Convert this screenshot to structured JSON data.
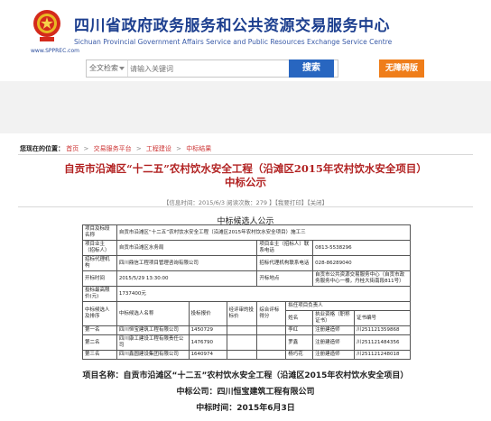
{
  "header": {
    "site_title": "四川省政府政务服务和公共资源交易服务中心",
    "site_subtitle": "Sichuan Provincial Government Affairs Service and Public Resources Exchange Service Centre",
    "domain": "www.SPPREC.com"
  },
  "search": {
    "scope": "全文检索",
    "placeholder": "请输入关键词",
    "button": "搜索",
    "accessibility_button": "无障碍版"
  },
  "breadcrumb": {
    "label": "您现在的位置：",
    "items": [
      "首页",
      "交易服务平台",
      "工程建设",
      "中标结果"
    ]
  },
  "article": {
    "title_line1": "自贡市沿滩区“十二五”农村饮水安全工程（沿滩区2015年农村饮水安全项目）",
    "title_line2": "中标公示",
    "meta": "【信息时间：2015/6/3  阅读次数：279 】【我要打印】【关闭】"
  },
  "notice": {
    "title": "中标候选人公示",
    "rows": {
      "project_name_label": "项目及标段名称",
      "project_name": "自贡市沿滩区“十二五”农村饮水安全工程（沿滩区2015年农村饮水安全项目）施工三",
      "owner_label": "项目业主（招标人）",
      "owner": "自贡市沿滩区水务局",
      "owner_contact_label": "项目业主（招标人）联系电话",
      "owner_contact": "0813-5538296",
      "agent_label": "招标代理机构",
      "agent": "四川鼎信工程项目管理咨询有限公司",
      "agent_contact_label": "招标代理机构联系电话",
      "agent_contact": "028-86289040",
      "open_time_label": "开标时间",
      "open_time": "2015/5/29  13:30:00",
      "open_place_label": "开标地点",
      "open_place": "自贡市公共资源交易服务中心（自贡市政务服务中心一楼，丹桂大街南段811号）",
      "max_price_label": "投标最高限价(元)",
      "max_price": "1737400元"
    },
    "candidate_headers": {
      "rank": "中标候选人及排序",
      "name": "中标候选人名称",
      "price": "投标报价",
      "deviation": "经评审的投标价",
      "score": "综合评标得分",
      "pm": "拟任项目负责人",
      "pm_name": "姓名",
      "pm_cert_name": "执业资格（职称证书）",
      "pm_cert_no": "证书编号"
    },
    "candidates": [
      {
        "rank": "第一名",
        "name": "四川恒宝建筑工程有限公司",
        "price": "1450729",
        "pm": "李红",
        "cert": "注册建造师",
        "cert_no": "川251121359868"
      },
      {
        "rank": "第二名",
        "name": "四川康工建设工程有限责任公司",
        "price": "1476790",
        "pm": "罗鑫",
        "cert": "注册建造师",
        "cert_no": "川251121484356"
      },
      {
        "rank": "第三名",
        "name": "四川鑫圆建设集团有限公司",
        "price": "1640974",
        "pm": "杨巧花",
        "cert": "注册建造师",
        "cert_no": "川251121248018"
      }
    ]
  },
  "caption": {
    "line1": "项目名称：自贡市沿滩区“十二五”农村饮水安全工程（沿滩区2015年农村饮水安全项目）",
    "line2": "中标公司：四川恒宝建筑工程有限公司",
    "line3": "中标时间：2015年6月3日"
  },
  "colors": {
    "brand_blue": "#1d3f8f",
    "search_button": "#2866c0",
    "accessibility_button": "#ef7d1a",
    "title_red": "#b22222"
  }
}
